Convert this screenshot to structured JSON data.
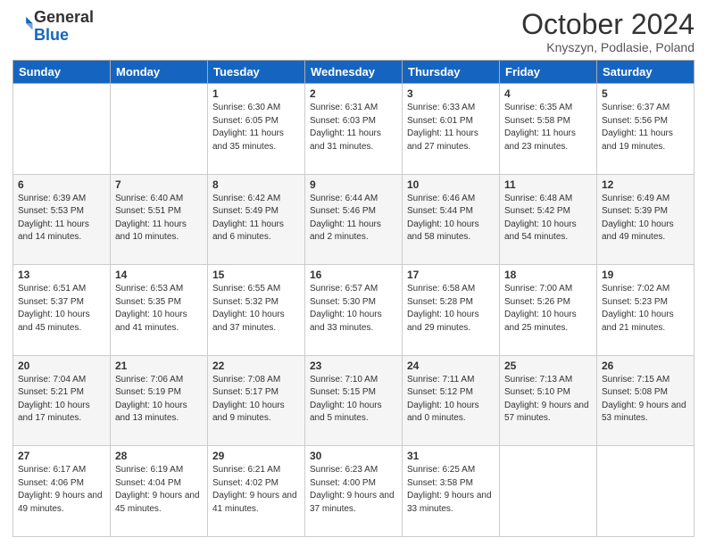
{
  "header": {
    "logo": {
      "line1": "General",
      "line2": "Blue"
    },
    "title": "October 2024",
    "location": "Knyszyn, Podlasie, Poland"
  },
  "weekdays": [
    "Sunday",
    "Monday",
    "Tuesday",
    "Wednesday",
    "Thursday",
    "Friday",
    "Saturday"
  ],
  "weeks": [
    [
      {
        "day": "",
        "info": ""
      },
      {
        "day": "",
        "info": ""
      },
      {
        "day": "1",
        "info": "Sunrise: 6:30 AM\nSunset: 6:05 PM\nDaylight: 11 hours and 35 minutes."
      },
      {
        "day": "2",
        "info": "Sunrise: 6:31 AM\nSunset: 6:03 PM\nDaylight: 11 hours and 31 minutes."
      },
      {
        "day": "3",
        "info": "Sunrise: 6:33 AM\nSunset: 6:01 PM\nDaylight: 11 hours and 27 minutes."
      },
      {
        "day": "4",
        "info": "Sunrise: 6:35 AM\nSunset: 5:58 PM\nDaylight: 11 hours and 23 minutes."
      },
      {
        "day": "5",
        "info": "Sunrise: 6:37 AM\nSunset: 5:56 PM\nDaylight: 11 hours and 19 minutes."
      }
    ],
    [
      {
        "day": "6",
        "info": "Sunrise: 6:39 AM\nSunset: 5:53 PM\nDaylight: 11 hours and 14 minutes."
      },
      {
        "day": "7",
        "info": "Sunrise: 6:40 AM\nSunset: 5:51 PM\nDaylight: 11 hours and 10 minutes."
      },
      {
        "day": "8",
        "info": "Sunrise: 6:42 AM\nSunset: 5:49 PM\nDaylight: 11 hours and 6 minutes."
      },
      {
        "day": "9",
        "info": "Sunrise: 6:44 AM\nSunset: 5:46 PM\nDaylight: 11 hours and 2 minutes."
      },
      {
        "day": "10",
        "info": "Sunrise: 6:46 AM\nSunset: 5:44 PM\nDaylight: 10 hours and 58 minutes."
      },
      {
        "day": "11",
        "info": "Sunrise: 6:48 AM\nSunset: 5:42 PM\nDaylight: 10 hours and 54 minutes."
      },
      {
        "day": "12",
        "info": "Sunrise: 6:49 AM\nSunset: 5:39 PM\nDaylight: 10 hours and 49 minutes."
      }
    ],
    [
      {
        "day": "13",
        "info": "Sunrise: 6:51 AM\nSunset: 5:37 PM\nDaylight: 10 hours and 45 minutes."
      },
      {
        "day": "14",
        "info": "Sunrise: 6:53 AM\nSunset: 5:35 PM\nDaylight: 10 hours and 41 minutes."
      },
      {
        "day": "15",
        "info": "Sunrise: 6:55 AM\nSunset: 5:32 PM\nDaylight: 10 hours and 37 minutes."
      },
      {
        "day": "16",
        "info": "Sunrise: 6:57 AM\nSunset: 5:30 PM\nDaylight: 10 hours and 33 minutes."
      },
      {
        "day": "17",
        "info": "Sunrise: 6:58 AM\nSunset: 5:28 PM\nDaylight: 10 hours and 29 minutes."
      },
      {
        "day": "18",
        "info": "Sunrise: 7:00 AM\nSunset: 5:26 PM\nDaylight: 10 hours and 25 minutes."
      },
      {
        "day": "19",
        "info": "Sunrise: 7:02 AM\nSunset: 5:23 PM\nDaylight: 10 hours and 21 minutes."
      }
    ],
    [
      {
        "day": "20",
        "info": "Sunrise: 7:04 AM\nSunset: 5:21 PM\nDaylight: 10 hours and 17 minutes."
      },
      {
        "day": "21",
        "info": "Sunrise: 7:06 AM\nSunset: 5:19 PM\nDaylight: 10 hours and 13 minutes."
      },
      {
        "day": "22",
        "info": "Sunrise: 7:08 AM\nSunset: 5:17 PM\nDaylight: 10 hours and 9 minutes."
      },
      {
        "day": "23",
        "info": "Sunrise: 7:10 AM\nSunset: 5:15 PM\nDaylight: 10 hours and 5 minutes."
      },
      {
        "day": "24",
        "info": "Sunrise: 7:11 AM\nSunset: 5:12 PM\nDaylight: 10 hours and 0 minutes."
      },
      {
        "day": "25",
        "info": "Sunrise: 7:13 AM\nSunset: 5:10 PM\nDaylight: 9 hours and 57 minutes."
      },
      {
        "day": "26",
        "info": "Sunrise: 7:15 AM\nSunset: 5:08 PM\nDaylight: 9 hours and 53 minutes."
      }
    ],
    [
      {
        "day": "27",
        "info": "Sunrise: 6:17 AM\nSunset: 4:06 PM\nDaylight: 9 hours and 49 minutes."
      },
      {
        "day": "28",
        "info": "Sunrise: 6:19 AM\nSunset: 4:04 PM\nDaylight: 9 hours and 45 minutes."
      },
      {
        "day": "29",
        "info": "Sunrise: 6:21 AM\nSunset: 4:02 PM\nDaylight: 9 hours and 41 minutes."
      },
      {
        "day": "30",
        "info": "Sunrise: 6:23 AM\nSunset: 4:00 PM\nDaylight: 9 hours and 37 minutes."
      },
      {
        "day": "31",
        "info": "Sunrise: 6:25 AM\nSunset: 3:58 PM\nDaylight: 9 hours and 33 minutes."
      },
      {
        "day": "",
        "info": ""
      },
      {
        "day": "",
        "info": ""
      }
    ]
  ]
}
